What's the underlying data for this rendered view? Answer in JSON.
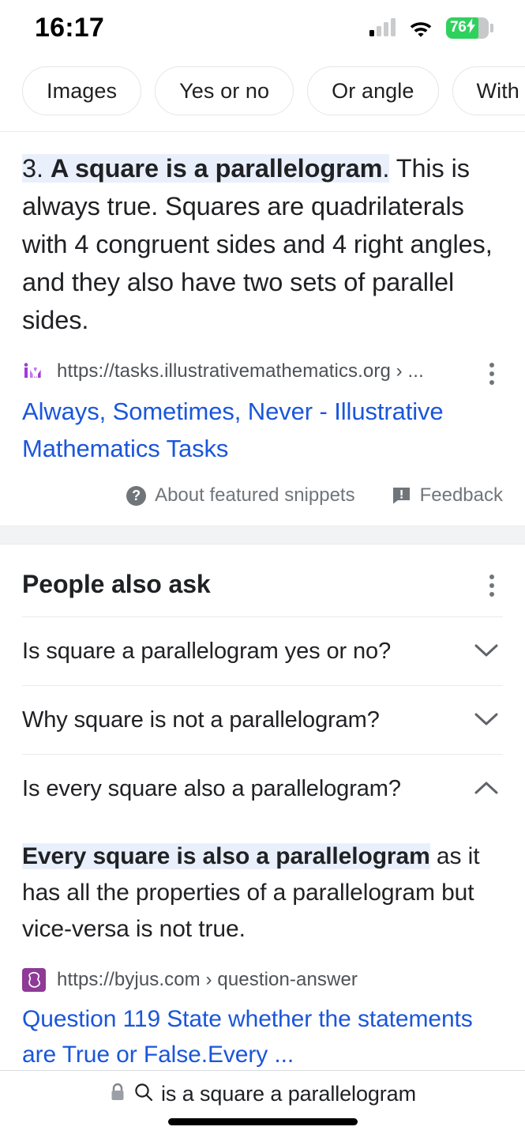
{
  "status_bar": {
    "time": "16:17",
    "signal_icon": "cellular-signal-icon",
    "wifi_icon": "wifi-icon",
    "battery_percent": "76",
    "battery_charging": true,
    "battery_color": "#2fd15d"
  },
  "chips": [
    {
      "label": "Images",
      "name": "filter-chip-images"
    },
    {
      "label": "Yes or no",
      "name": "filter-chip-yes-or-no"
    },
    {
      "label": "Or angle",
      "name": "filter-chip-or-angle"
    },
    {
      "label": "With equal sides",
      "name": "filter-chip-with-equal-sides"
    }
  ],
  "featured_snippet": {
    "number_prefix": "3. ",
    "highlighted_bold": "A square is a parallelogram",
    "highlighted_tail": ".",
    "body": " This is always true. Squares are quadrilaterals with 4 congruent sides and 4 right angles, and they also have two sets of parallel sides.",
    "source": {
      "favicon_text": "iM",
      "favicon_name": "illustrative-mathematics-favicon",
      "url": "https://tasks.illustrativemathematics.org › ...",
      "title": "Always, Sometimes, Never - Illustrative Mathematics Tasks",
      "title_color": "#1a56db"
    },
    "footer": {
      "about_label": "About featured snippets",
      "about_icon": "help-circle-icon",
      "feedback_label": "Feedback",
      "feedback_icon": "feedback-icon"
    },
    "overflow_icon": "kebab-menu-icon"
  },
  "people_also_ask": {
    "title": "People also ask",
    "overflow_icon": "kebab-menu-icon",
    "questions": [
      {
        "text": "Is square a parallelogram yes or no?",
        "expanded": false,
        "chevron": "chevron-down-icon"
      },
      {
        "text": "Why square is not a parallelogram?",
        "expanded": false,
        "chevron": "chevron-down-icon"
      },
      {
        "text": "Is every square also a parallelogram?",
        "expanded": true,
        "chevron": "chevron-up-icon",
        "answer_highlighted": "Every square is also a parallelogram",
        "answer_rest": " as it has all the properties of a parallelogram but vice-versa is not true.",
        "source": {
          "favicon_text": "B",
          "favicon_name": "byjus-favicon",
          "favicon_color": "#8e3a96",
          "url": "https://byjus.com › question-answer",
          "title": "Question 119 State whether the statements are True or False.Every ...",
          "title_color": "#1a56db"
        }
      }
    ]
  },
  "bottom_bar": {
    "lock_icon": "lock-icon",
    "search_icon": "search-icon",
    "query": "is a square a parallelogram",
    "home_indicator": "home-indicator"
  },
  "colors": {
    "highlight": "#e9f0fb",
    "link": "#1a56db",
    "text": "#202124",
    "muted": "#70757a",
    "section_band": "#f1f3f4"
  }
}
